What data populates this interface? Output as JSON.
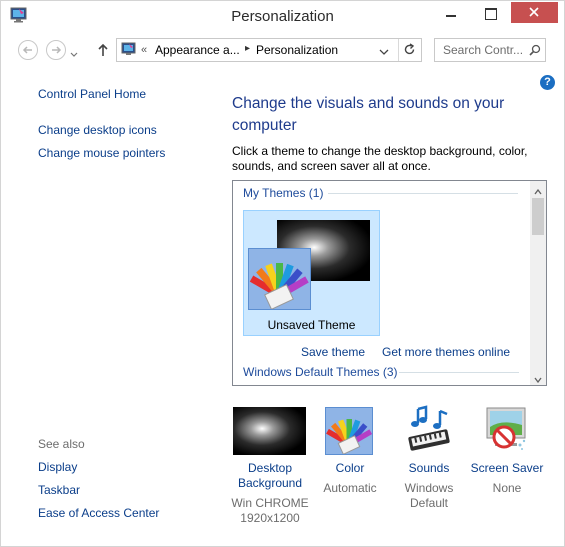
{
  "window": {
    "title": "Personalization"
  },
  "address_bar": {
    "overflow_marker": "«",
    "crumbs": [
      "Appearance a...",
      "Personalization"
    ],
    "search_placeholder": "Search Contr..."
  },
  "left_pane": {
    "links": [
      "Control Panel Home",
      "Change desktop icons",
      "Change mouse pointers"
    ],
    "see_also_label": "See also",
    "see_also_links": [
      "Display",
      "Taskbar",
      "Ease of Access Center"
    ]
  },
  "main": {
    "heading": "Change the visuals and sounds on your computer",
    "description": "Click a theme to change the desktop background, color, sounds, and screen saver all at once.",
    "themes": {
      "my_themes_label": "My Themes (1)",
      "selected_theme": "Unsaved Theme",
      "save_theme_link": "Save theme",
      "get_more_link": "Get more themes online",
      "windows_default_label": "Windows Default Themes (3)"
    }
  },
  "bottom_tiles": [
    {
      "label": "Desktop Background",
      "sub1": "Win CHROME",
      "sub2": "1920x1200"
    },
    {
      "label": "Color",
      "sub1": "Automatic"
    },
    {
      "label": "Sounds",
      "sub1": "Windows Default"
    },
    {
      "label": "Screen Saver",
      "sub1": "None"
    }
  ],
  "colors": {
    "link": "#0b3e8a",
    "heading": "#1e3b8c",
    "selection": "#cce8ff",
    "close": "#c75050"
  }
}
